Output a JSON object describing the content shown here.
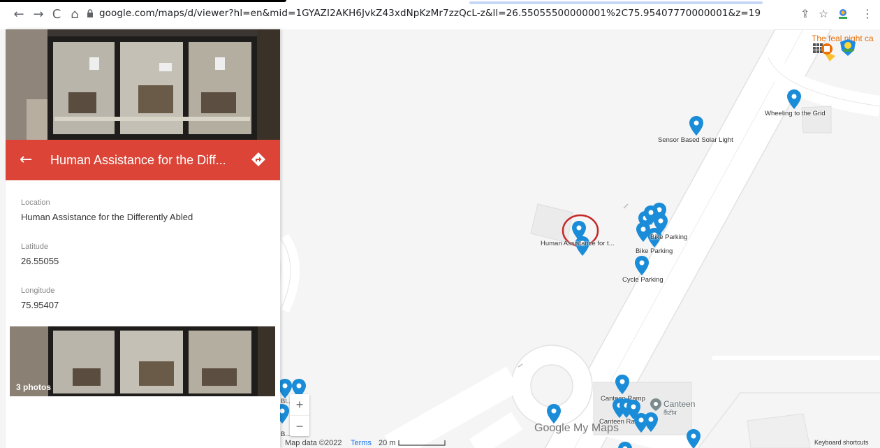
{
  "browser": {
    "url": "google.com/maps/d/viewer?hl=en&mid=1GYAZI2AKH6JvkZ43xdNpKzMr7zzQcL-z&ll=26.55055500000001%2C75.95407770000001&z=19",
    "icons": [
      "back-icon",
      "forward-icon",
      "reload-icon",
      "home-icon",
      "lock-icon",
      "share-icon",
      "star-icon",
      "extension-icon",
      "menu-icon"
    ]
  },
  "panel": {
    "title": "Human Assistance for the Diff...",
    "header_color": "#db4437",
    "location_label": "Location",
    "location_value": "Human Assistance for the Differently Abled",
    "latitude_label": "Latitude",
    "latitude_value": "26.55055",
    "longitude_label": "Longitude",
    "longitude_value": "75.95407",
    "photo_count": "3 photos"
  },
  "map": {
    "pin_color": "#1a8cd8",
    "labels": {
      "wheeling": "Wheeling to the Grid",
      "sensor": "Sensor Based Solar Light",
      "human": "Human Assistance for t...",
      "bike1": "Bike Parking",
      "bike2": "Bike Parking",
      "cycle": "Cycle Parking",
      "canteen_ramp1": "Canteen Ramp",
      "canteen_ramp2": "Canteen Ramp",
      "canteen": "Canteen",
      "canteen_hi": "कैंटीन",
      "bl_ramp": "Bl... amp",
      "b3": "B..."
    },
    "top_right_text": "The feal night ca",
    "brand": "Google My Maps",
    "map_data": "Map data ©2022",
    "terms": "Terms",
    "scale": "20 m",
    "keyboard": "Keyboard shortcuts",
    "zoom_in": "+",
    "zoom_out": "−"
  }
}
